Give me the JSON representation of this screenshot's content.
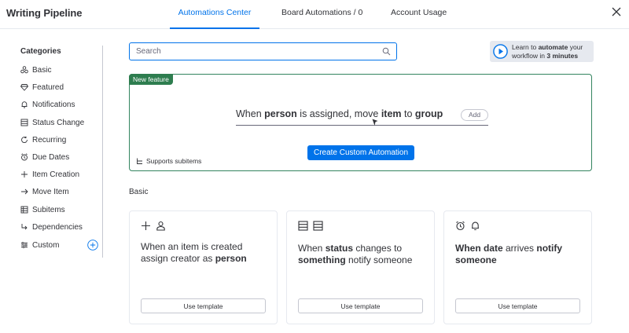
{
  "app": {
    "title": "Writing Pipeline"
  },
  "tabs": [
    {
      "label": "Automations Center"
    },
    {
      "label": "Board Automations / 0"
    },
    {
      "label": "Account Usage"
    }
  ],
  "sidebar": {
    "title": "Categories",
    "items": [
      {
        "label": "Basic",
        "icon": "basic-icon"
      },
      {
        "label": "Featured",
        "icon": "featured-icon"
      },
      {
        "label": "Notifications",
        "icon": "bell-icon"
      },
      {
        "label": "Status Change",
        "icon": "status-change-icon"
      },
      {
        "label": "Recurring",
        "icon": "recurring-icon"
      },
      {
        "label": "Due Dates",
        "icon": "due-dates-icon"
      },
      {
        "label": "Item Creation",
        "icon": "plus-icon"
      },
      {
        "label": "Move Item",
        "icon": "arrow-right-icon"
      },
      {
        "label": "Subitems",
        "icon": "subitems-icon"
      },
      {
        "label": "Dependencies",
        "icon": "dependencies-icon"
      },
      {
        "label": "Custom",
        "icon": "custom-icon"
      }
    ]
  },
  "search": {
    "placeholder": "Search",
    "value": ""
  },
  "learn": {
    "prefix": "Learn to ",
    "bold1": "automate",
    "mid": " your workflow in ",
    "bold2": "3 minutes"
  },
  "feature": {
    "badge": "New feature",
    "recipe": {
      "t1": "When ",
      "b1": "person",
      "t2": " is assigned, move ",
      "b2": "item",
      "t3": " to ",
      "b3": "group"
    },
    "add_label": "Add",
    "create_button": "Create Custom Automation",
    "supports": "Supports subitems"
  },
  "section": {
    "title": "Basic"
  },
  "cards": [
    {
      "line1": "When an item is created",
      "line2": "assign creator as ",
      "bold": "person",
      "button": "Use template"
    },
    {
      "t1": "When ",
      "b1": "status",
      "t2": " changes to",
      "b2": "something",
      "t3": " notify someone",
      "button": "Use template"
    },
    {
      "b1": "When date",
      "t1": " arrives ",
      "b2": "notify",
      "b3": "someone",
      "button": "Use template"
    }
  ],
  "colors": {
    "accent": "#0073ea",
    "feature_green": "#2e7d4f",
    "text": "#323338"
  }
}
